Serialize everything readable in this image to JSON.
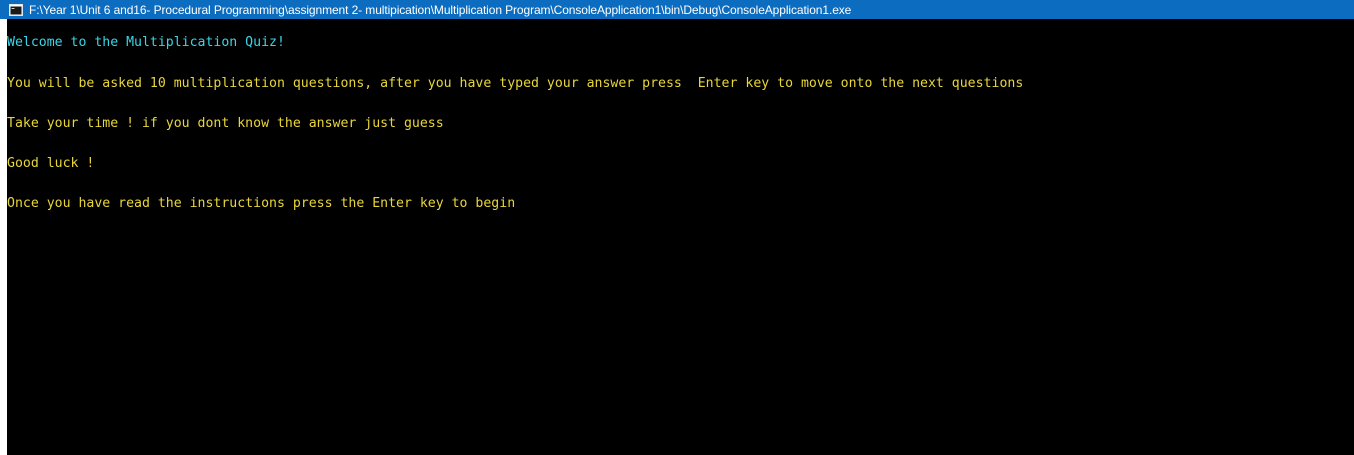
{
  "window": {
    "title": "F:\\Year 1\\Unit 6 and16- Procedural Programming\\assignment 2- multipication\\Multiplication Program\\ConsoleApplication1\\bin\\Debug\\ConsoleApplication1.exe",
    "icon": "console-window-icon"
  },
  "console": {
    "colors": {
      "background": "#000000",
      "welcome": "#3ad6e8",
      "text": "#e8d63a",
      "titlebar": "#0c6cbf"
    },
    "lines": [
      "Welcome to the Multiplication Quiz!",
      "You will be asked 10 multiplication questions, after you have typed your answer press  Enter key to move onto the next questions",
      "Take your time ! if you dont know the answer just guess",
      "Good luck !",
      "Once you have read the instructions press the Enter key to begin"
    ]
  }
}
